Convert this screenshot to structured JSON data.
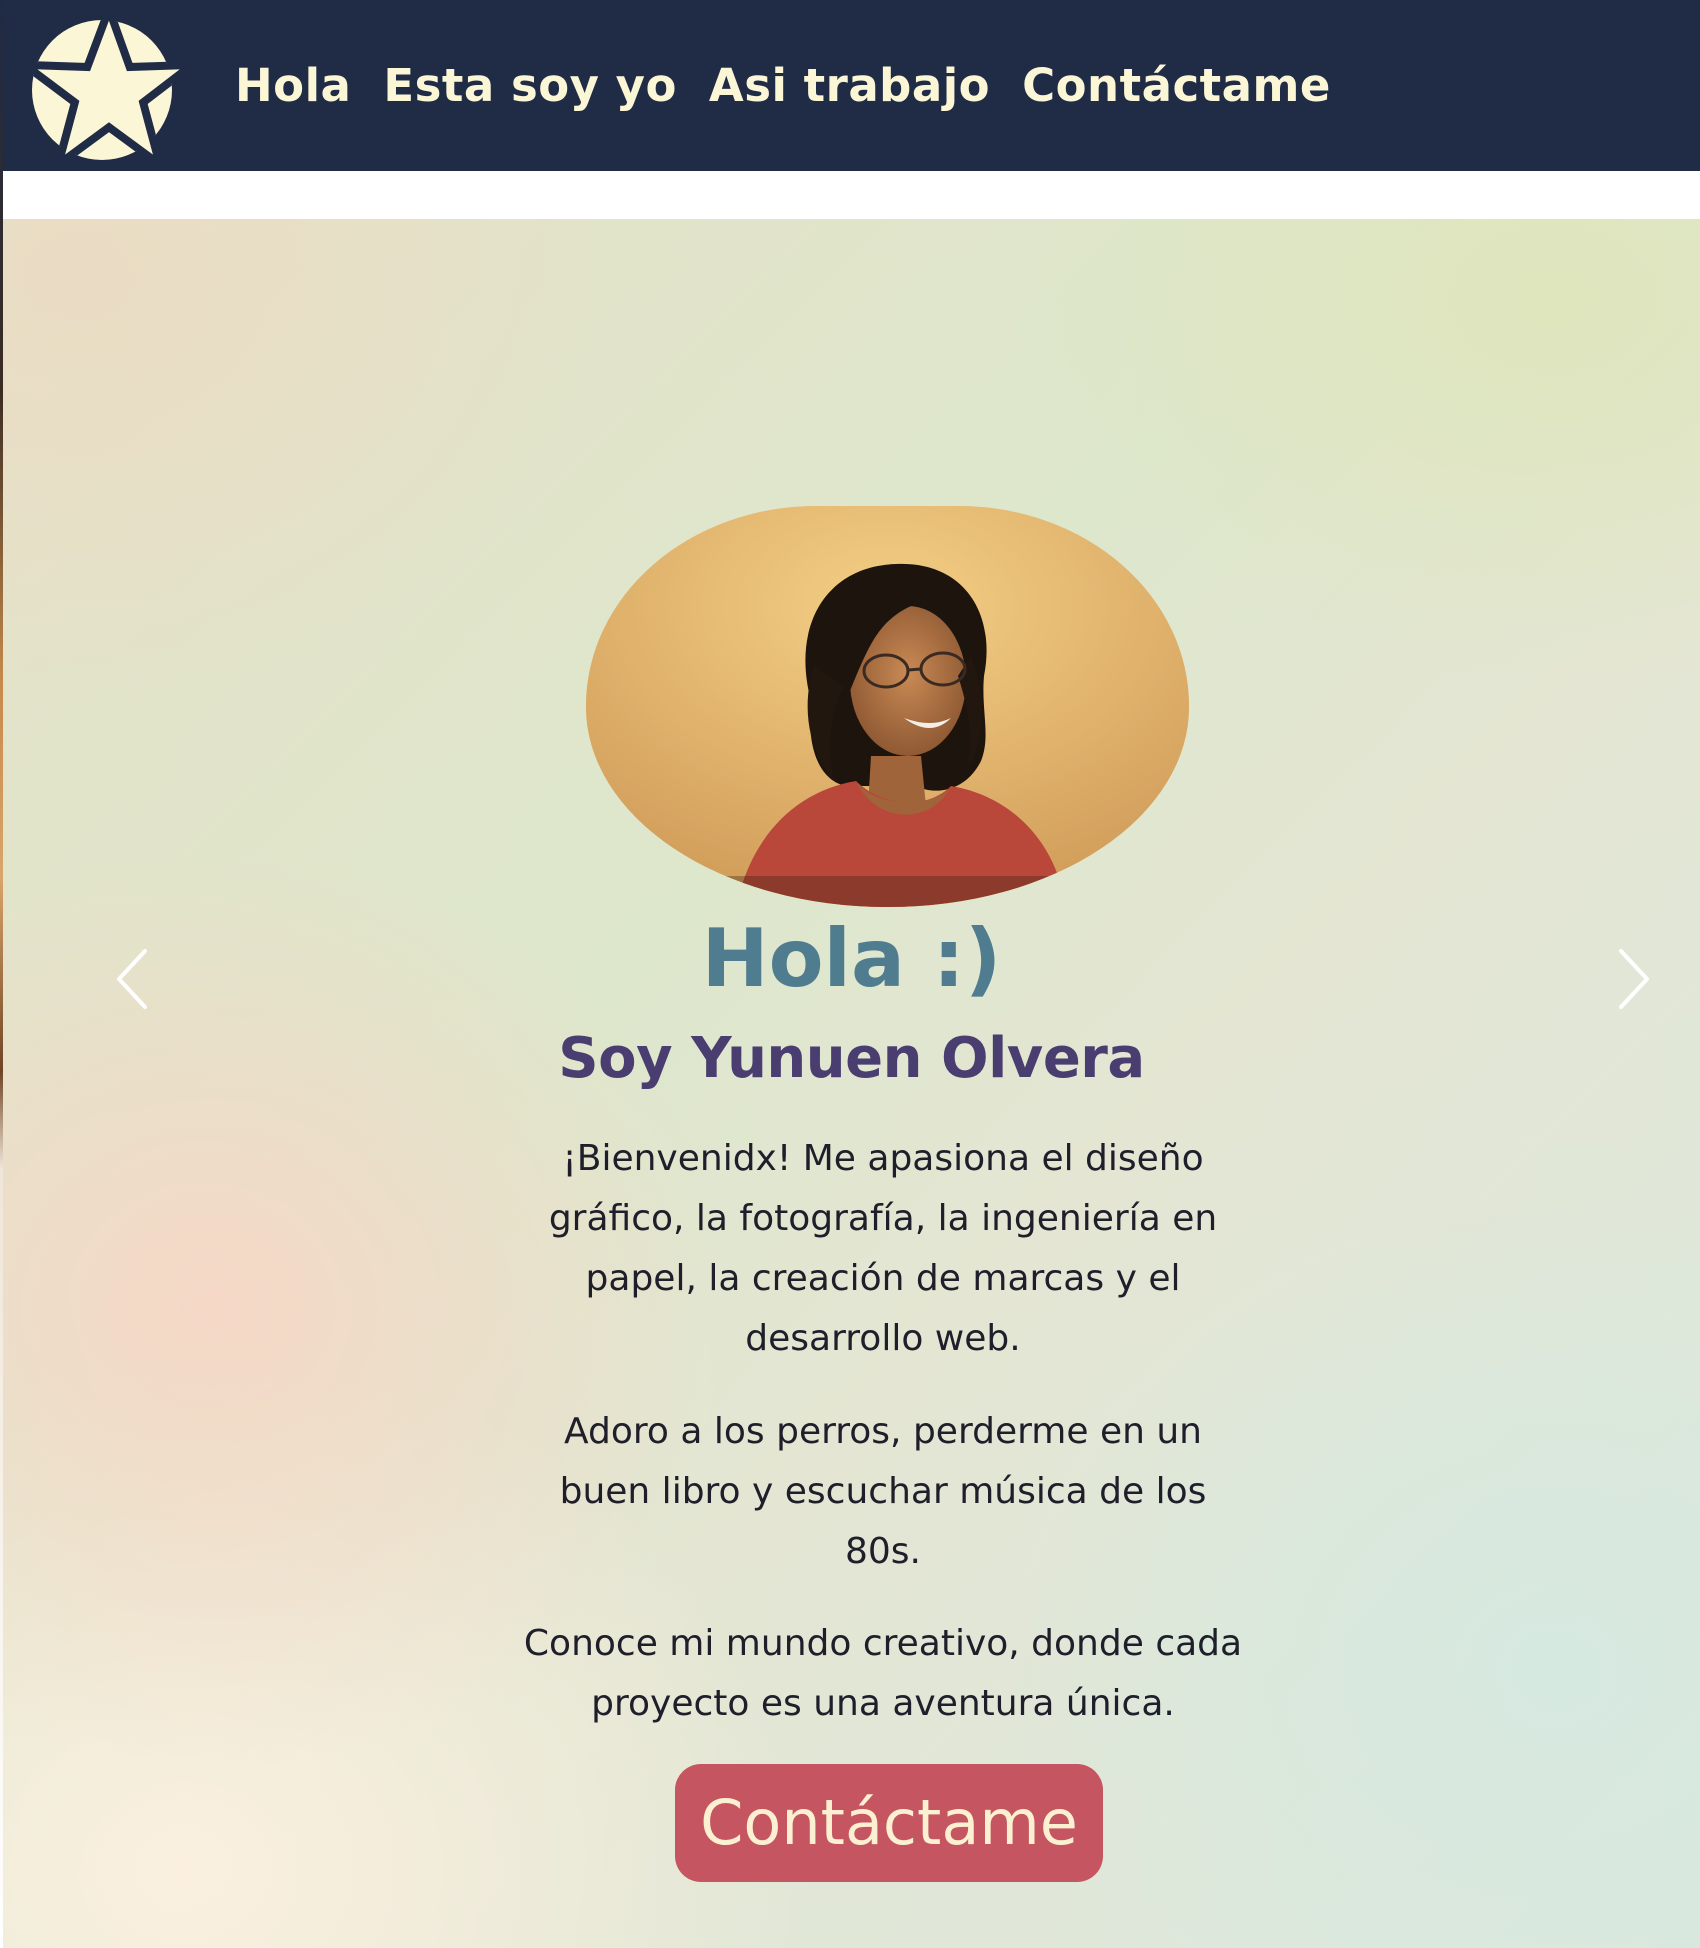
{
  "navbar": {
    "logo_icon": "star-logo-icon",
    "links": [
      {
        "label": "Hola"
      },
      {
        "label": "Esta soy yo"
      },
      {
        "label": "Asi trabajo"
      },
      {
        "label": "Contáctame"
      }
    ]
  },
  "hero": {
    "title": "Hola :)",
    "subtitle": "Soy Yunuen Olvera",
    "paragraphs": [
      "¡Bienvenidx! Me apasiona el diseño gráfico, la fotografía, la ingeniería en papel, la creación de marcas y el desarrollo web.",
      "Adoro a los perros, perderme en un buen libro y escuchar música de los 80s.",
      "Conoce mi mundo creativo, donde cada proyecto es una aventura única."
    ],
    "cta_label": "Contáctame",
    "prev_icon": "chevron-left-icon",
    "next_icon": "chevron-right-icon"
  },
  "colors": {
    "nav_background": "#202c46",
    "nav_text": "#fbf6d6",
    "title": "#4f7c8f",
    "subtitle": "#4a3e70",
    "button_background": "#c45561",
    "button_text": "#fbf1d2"
  }
}
